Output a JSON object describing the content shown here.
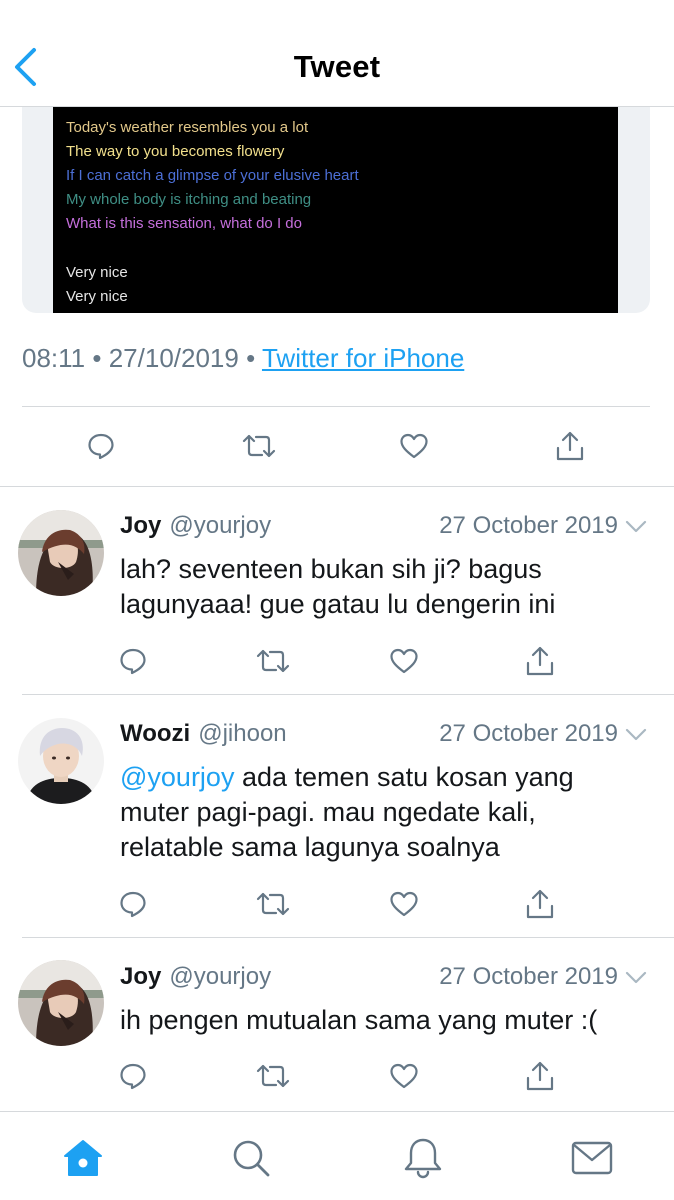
{
  "header": {
    "title": "Tweet"
  },
  "tweet": {
    "media": {
      "lines": [
        {
          "text": "Today's weather resembles you a lot",
          "color": "#e2c88a"
        },
        {
          "text": "The way to you becomes flowery",
          "color": "#f2e08c"
        },
        {
          "text": "If I can catch a glimpse of your elusive heart",
          "color": "#4c6fd6"
        },
        {
          "text": "My whole body is itching and beating",
          "color": "#3f8f85"
        },
        {
          "text": "What is this sensation, what do I do",
          "color": "#c56fdc"
        },
        {
          "text": "Very nice",
          "color": "#e6e6e6"
        },
        {
          "text": "Very nice",
          "color": "#e6e6e6"
        }
      ]
    },
    "time": "08:11",
    "date": "27/10/2019",
    "separator": "•",
    "source": "Twitter for iPhone"
  },
  "replies": [
    {
      "name": "Joy",
      "handle": "@yourjoy",
      "date": "27 October 2019",
      "mention": "",
      "text": "lah? seventeen bukan sih ji? bagus lagunyaaa! gue gatau lu dengerin ini"
    },
    {
      "name": "Woozi",
      "handle": "@jihoon",
      "date": "27 October 2019",
      "mention": "@yourjoy",
      "text": "ada temen satu kosan yang muter pagi-pagi. mau ngedate kali, relatable sama lagunya soalnya"
    },
    {
      "name": "Joy",
      "handle": "@yourjoy",
      "date": "27 October 2019",
      "mention": "",
      "text": "ih pengen mutualan sama yang muter :("
    }
  ],
  "icons": {
    "back": "chevron-left-icon",
    "reply": "reply-bubble-icon",
    "retweet": "retweet-icon",
    "like": "heart-icon",
    "share": "share-icon",
    "caret": "chevron-down-icon",
    "tabs": [
      "home-icon",
      "search-icon",
      "notifications-bell-icon",
      "messages-envelope-icon"
    ]
  },
  "colors": {
    "accent": "#1da1f2",
    "text": "#14171a",
    "muted": "#657786",
    "border": "#d6d9dc"
  }
}
